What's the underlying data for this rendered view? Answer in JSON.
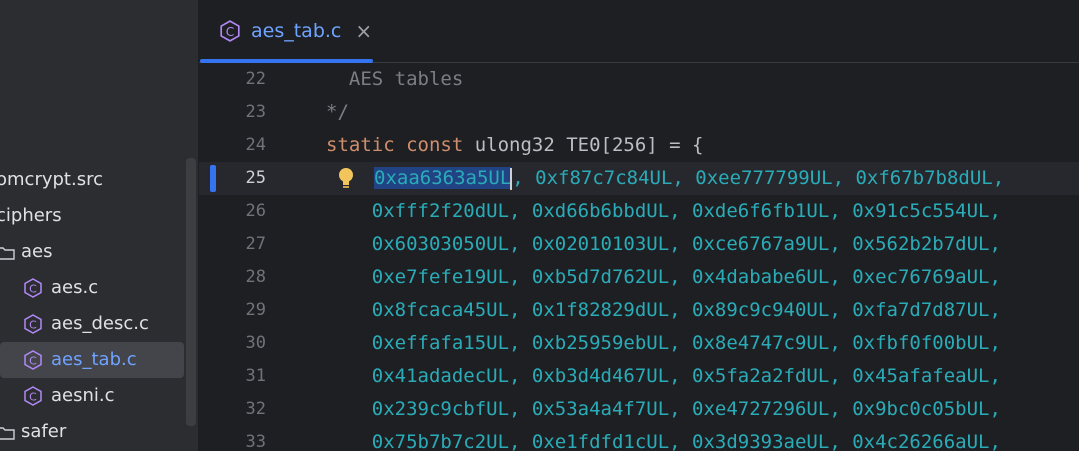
{
  "sidebar": {
    "tree": [
      {
        "label": "omcrypt.src",
        "type": "root"
      },
      {
        "label": "ciphers",
        "type": "folder"
      },
      {
        "label": "aes",
        "type": "folder"
      },
      {
        "label": "aes.c",
        "type": "c-file"
      },
      {
        "label": "aes_desc.c",
        "type": "c-file"
      },
      {
        "label": "aes_tab.c",
        "type": "c-file",
        "selected": true
      },
      {
        "label": "aesni.c",
        "type": "c-file"
      },
      {
        "label": "safer",
        "type": "folder"
      }
    ]
  },
  "tab": {
    "label": "aes_tab.c",
    "close": "×",
    "icon": "c-file-icon"
  },
  "editor": {
    "lines": [
      {
        "num": "22",
        "text": "  AES tables"
      },
      {
        "num": "23",
        "text": "*/"
      },
      {
        "num": "24",
        "kw": "static const",
        "rest": " ulong32 TE0[256] = {"
      },
      {
        "num": "25",
        "selected": "0xaa6363a5UL",
        "rest": ", 0xf87c7c84UL, 0xee777799UL, 0xf67b7b8dUL,"
      },
      {
        "num": "26",
        "text": "    0xfff2f20dUL, 0xd66b6bbdUL, 0xde6f6fb1UL, 0x91c5c554UL,"
      },
      {
        "num": "27",
        "text": "    0x60303050UL, 0x02010103UL, 0xce6767a9UL, 0x562b2b7dUL,"
      },
      {
        "num": "28",
        "text": "    0xe7fefe19UL, 0xb5d7d762UL, 0x4dababe6UL, 0xec76769aUL,"
      },
      {
        "num": "29",
        "text": "    0x8fcaca45UL, 0x1f82829dUL, 0x89c9c940UL, 0xfa7d7d87UL,"
      },
      {
        "num": "30",
        "text": "    0xeffafa15UL, 0xb25959ebUL, 0x8e4747c9UL, 0xfbf0f00bUL,"
      },
      {
        "num": "31",
        "text": "    0x41adadecUL, 0xb3d4d467UL, 0x5fa2a2fdUL, 0x45afafeaUL,"
      },
      {
        "num": "32",
        "text": "    0x239c9cbfUL, 0x53a4a4f7UL, 0xe4727296UL, 0x9bc0c05bUL,"
      },
      {
        "num": "33",
        "text": "    0x75b7b7c2UL, 0xe1fdfd1cUL, 0x3d9393aeUL, 0x4c26266aUL,"
      }
    ]
  },
  "colors": {
    "accent": "#3574f0",
    "selection": "#214283",
    "keyword": "#cf8e6d",
    "number": "#2aacb8"
  }
}
